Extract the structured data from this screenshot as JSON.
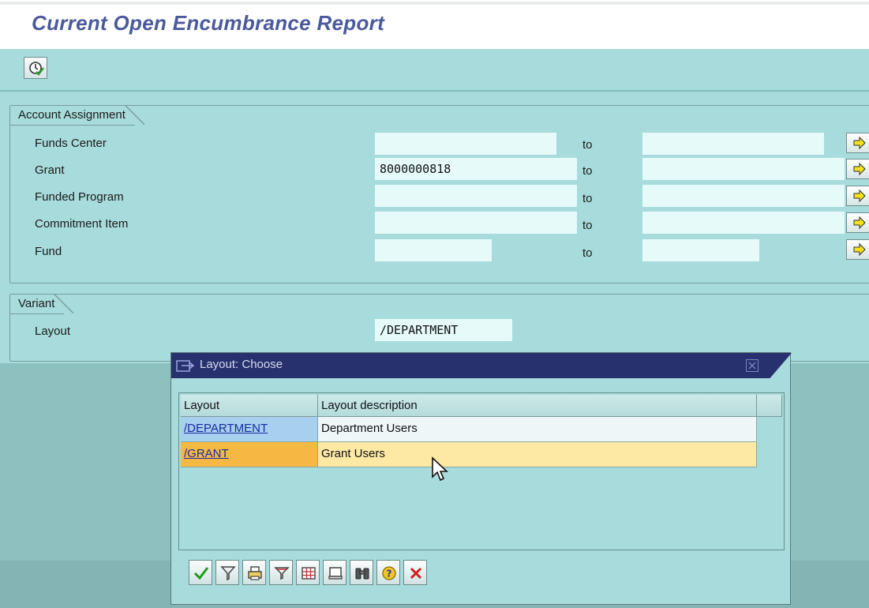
{
  "page": {
    "title": "Current Open Encumbrance Report"
  },
  "toolbar": {
    "execute_icon": "clock-execute-icon"
  },
  "account_assignment": {
    "title": "Account Assignment",
    "range_label": "to",
    "fields": [
      {
        "label": "Funds Center",
        "from_value": "",
        "to_value": ""
      },
      {
        "label": "Grant",
        "from_value": "8000000818",
        "to_value": ""
      },
      {
        "label": "Funded Program",
        "from_value": "",
        "to_value": ""
      },
      {
        "label": "Commitment Item",
        "from_value": "",
        "to_value": ""
      },
      {
        "label": "Fund",
        "from_value": "",
        "to_value": ""
      }
    ]
  },
  "variant": {
    "title": "Variant",
    "layout_label": "Layout",
    "layout_value": "/DEPARTMENT"
  },
  "dialog": {
    "title": "Layout: Choose",
    "columns": [
      "Layout",
      "Layout description"
    ],
    "rows": [
      {
        "layout": "/DEPARTMENT",
        "description": "Department Users",
        "state": "normal"
      },
      {
        "layout": "/GRANT",
        "description": "Grant Users",
        "state": "selected"
      }
    ],
    "toolbar_icons": [
      "check-icon",
      "filter-icon",
      "print-icon",
      "sort-icon",
      "grid-icon",
      "page-icon",
      "find-icon",
      "help-icon",
      "cancel-icon"
    ]
  },
  "colors": {
    "background": "#a8dcdc",
    "title_text": "#4a5a9a",
    "dialog_header": "#27316e",
    "selected_row": "#fde8a4",
    "selected_key": "#f4b843",
    "link_key_bg": "#a6d0ee"
  }
}
